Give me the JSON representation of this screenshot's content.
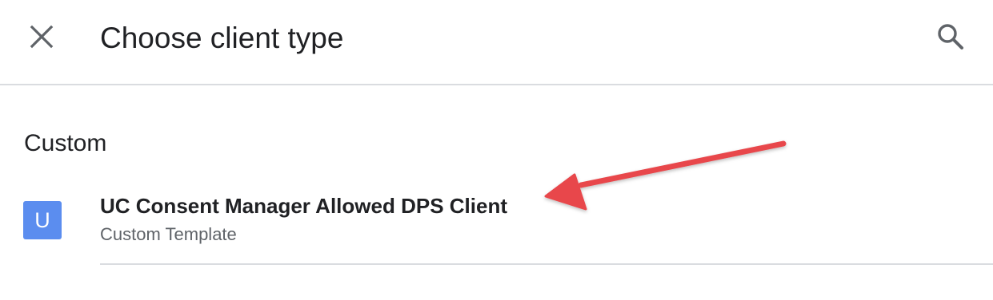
{
  "header": {
    "title": "Choose client type",
    "close_icon": "close-icon",
    "search_icon": "search-icon"
  },
  "section": {
    "heading": "Custom"
  },
  "items": [
    {
      "avatar_letter": "U",
      "title": "UC Consent Manager Allowed DPS Client",
      "subtitle": "Custom Template"
    }
  ],
  "colors": {
    "avatar_bg": "#5b8def",
    "annotation_arrow": "#e8474b",
    "divider": "#dadce0",
    "subtitle_text": "#5f6368"
  }
}
